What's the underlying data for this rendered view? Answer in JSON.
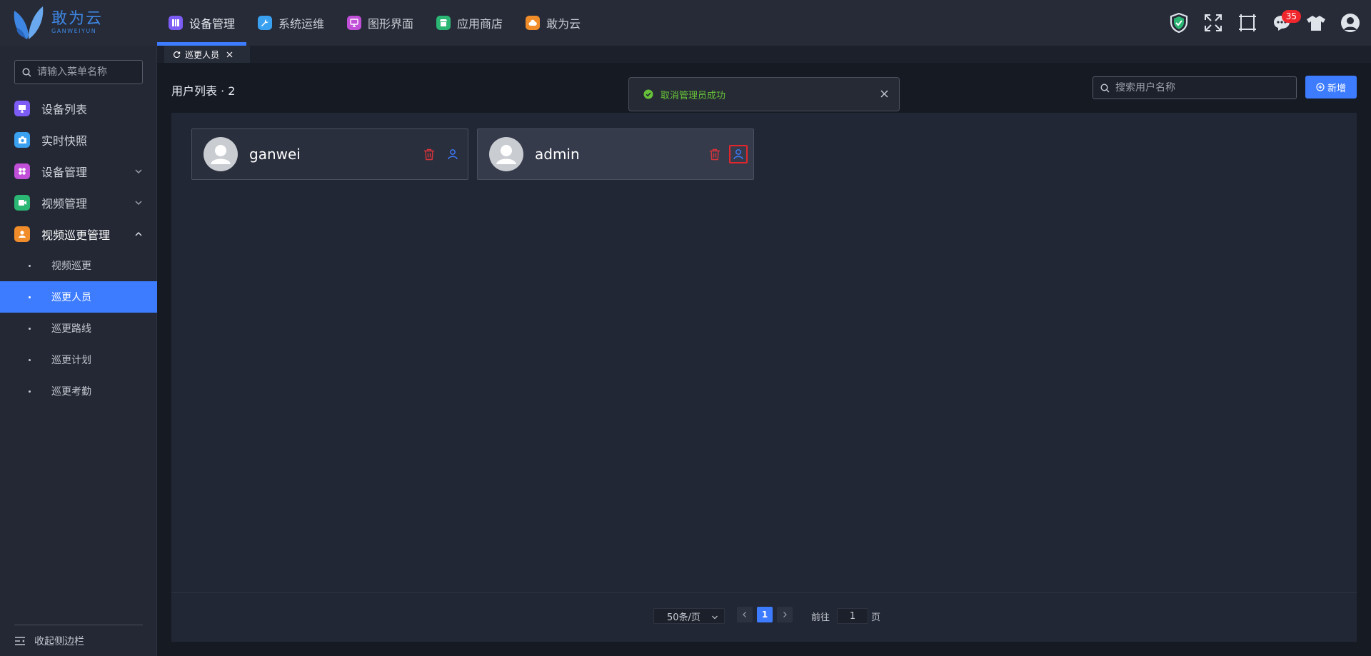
{
  "brand": {
    "name_cn": "敢为云",
    "name_en": "GANWEIYUN",
    "color": "#3e86e3"
  },
  "top_nav": [
    {
      "label": "设备管理",
      "icon": "device-grid-icon",
      "color": "#7c5cf5",
      "active": true
    },
    {
      "label": "系统运维",
      "icon": "wrench-icon",
      "color": "#3aa0f0"
    },
    {
      "label": "图形界面",
      "icon": "graphic-screen-icon",
      "color": "#c14fd8"
    },
    {
      "label": "应用商店",
      "icon": "store-icon",
      "color": "#2bb673"
    },
    {
      "label": "敢为云",
      "icon": "cloud-icon",
      "color": "#f08c2a"
    }
  ],
  "top_right": {
    "message_count": "35"
  },
  "sidebar": {
    "search_placeholder": "请输入菜单名称",
    "items": [
      {
        "label": "设备列表",
        "icon": "monitor-icon",
        "color": "#7c5cf5"
      },
      {
        "label": "实时快照",
        "icon": "camera-icon",
        "color": "#3aa0f0"
      },
      {
        "label": "设备管理",
        "icon": "modules-icon",
        "color": "#c14fd8"
      },
      {
        "label": "视频管理",
        "icon": "video-icon",
        "color": "#2bb673"
      },
      {
        "label": "视频巡更管理",
        "icon": "patrol-user-icon",
        "color": "#f08c2a"
      }
    ],
    "sub_items": [
      "视频巡更",
      "巡更人员",
      "巡更路线",
      "巡更计划",
      "巡更考勤"
    ],
    "active_sub": "巡更人员",
    "collapse_label": "收起侧边栏"
  },
  "tabs": [
    {
      "label": "巡更人员"
    }
  ],
  "main": {
    "list_title": "用户列表 · 2",
    "search_placeholder": "搜索用户名称",
    "add_label": "新增",
    "users": [
      {
        "name": "ganwei"
      },
      {
        "name": "admin"
      }
    ]
  },
  "pagination": {
    "page_size": "50条/页",
    "current_page": "1",
    "goto_prefix": "前往",
    "goto_value": "1",
    "goto_suffix": "页"
  },
  "toast": {
    "message": "取消管理员成功",
    "color": "#67c23a"
  },
  "accent_color": "#3d7cff"
}
